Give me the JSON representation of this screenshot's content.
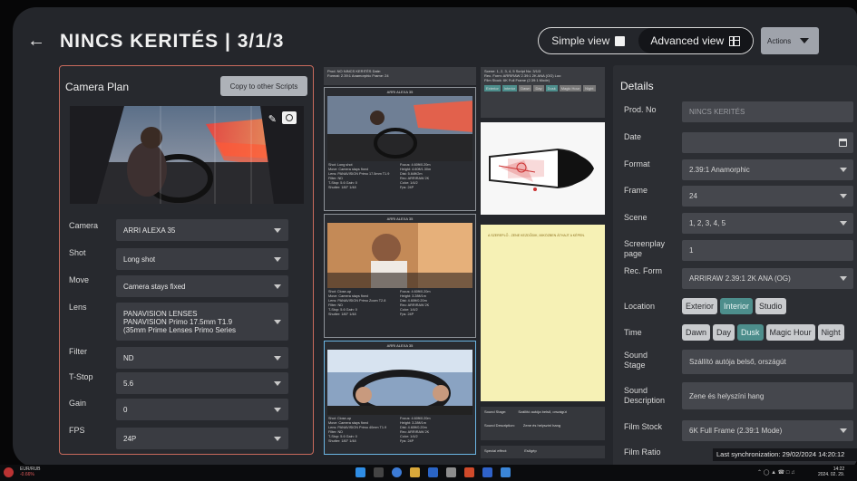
{
  "header": {
    "back_icon": "arrow-left-icon",
    "title": "NINCS KERITÉS | 3/1/3",
    "simple_view": "Simple view",
    "advanced_view": "Advanced view",
    "actions": "Actions"
  },
  "camera_plan": {
    "title": "Camera Plan",
    "copy_button": "Copy to other Scripts",
    "fields": [
      {
        "label": "Camera",
        "value": "ARRI ALEXA 35"
      },
      {
        "label": "Shot",
        "value": "Long shot"
      },
      {
        "label": "Move",
        "value": "Camera stays fixed"
      },
      {
        "label": "Lens",
        "value": "PANAVISION LENSES\nPANAVISION Primo 17.5mm T1.9\n(35mm Prime Lenses Primo Series"
      },
      {
        "label": "Filter",
        "value": "ND"
      },
      {
        "label": "T-Stop",
        "value": "5.6"
      },
      {
        "label": "Gain",
        "value": "0"
      },
      {
        "label": "FPS",
        "value": "24P"
      }
    ]
  },
  "script_pages": {
    "header_lines": [
      "Prod. NO  NINCS KERITÉS          Date:",
      "Format:  2.39:1 Anamorphic             Frame:  24"
    ],
    "scene_lines": [
      "Scene:   1, 2, 3, 4, 5          Script No:  3/1/3",
      "Rec. Form:  ARRIRAW 2.39:1 2K ANA (OG)   Loc:",
      "Film Stock:  6K Full Frame (2.39:1 Mode)"
    ],
    "shots": [
      {
        "header": "ARRI ALEXA 35",
        "meta": [
          "Shot:  Long shot",
          "Focus:  4.60ft/0.20m",
          "Move:  Camera stays fixed",
          "Height:  4.60ft/1.30m",
          "Lens:  PANAVISION Primo 17.5mm T1.9",
          "Dist:  5.64ft/2m",
          "Filter:  ND",
          "Rec:  ARRIRAW 2K",
          "T-Stop:  5.6   Gain: 0",
          "Color:  1/4/2",
          "Shutter:  180°   1/48",
          "Fps:  24P"
        ]
      },
      {
        "header": "ARRI ALEXA 35",
        "meta": [
          "Shot:  Close-up",
          "Focus:  4.60ft/0.20m",
          "Move:  Camera stays fixed",
          "Height:  3.28ft/1m",
          "Lens:  PANAVISION Primo Zoom T2.8",
          "Dist:  4.60ft/0.20m",
          "Filter:  ND",
          "Rec:  ARRIRAW 2K",
          "T-Stop:  5.6   Gain: 0",
          "Color:  1/4/2",
          "Shutter:  180°   1/48",
          "Fps:  24P"
        ]
      },
      {
        "header": "ARRI ALEXA 35",
        "meta": [
          "Shot:  Close-up",
          "Focus:  4.60ft/0.20m",
          "Move:  Camera stays fixed",
          "Height:  3.28ft/1m",
          "Lens:  PANAVISION Primo 40mm T1.9",
          "Dist:  4.60ft/0.20m",
          "Filter:  ND",
          "Rec:  ARRIRAW 2K",
          "T-Stop:  5.6   Gain: 0",
          "Color:  1/4/2",
          "Shutter:  180°   1/48",
          "Fps:  24P"
        ]
      }
    ],
    "chips": [
      "Exterior",
      "Interior",
      "Dawn",
      "Day",
      "Dusk",
      "Magic Hour",
      "Night"
    ],
    "note_text": "A SZEREPLŐ - ZENE KEZDŐDIK, MIKÖZBEN ÁTHAJT A KÉPEN.",
    "bottom_meta": [
      {
        "label": "Sound Stage:",
        "value": "Szállító autója belső, országút"
      },
      {
        "label": "Sound Description:",
        "value": "Zene és helyszíni hang"
      },
      {
        "label": "Special effect:",
        "value": "Esőgép"
      }
    ]
  },
  "details": {
    "title": "Details",
    "prod_no": {
      "label": "Prod. No",
      "value": "NINCS KERITÉS"
    },
    "date": {
      "label": "Date",
      "value": ""
    },
    "format": {
      "label": "Format",
      "value": "2.39:1 Anamorphic"
    },
    "frame": {
      "label": "Frame",
      "value": "24"
    },
    "scene": {
      "label": "Scene",
      "value": "1, 2, 3, 4, 5"
    },
    "screenplay_page": {
      "label": "Screenplay page",
      "value": "1"
    },
    "rec_form": {
      "label": "Rec. Form",
      "value": "ARRIRAW 2.39:1 2K ANA (OG)"
    },
    "location": {
      "label": "Location",
      "options": [
        "Exterior",
        "Interior",
        "Studio"
      ],
      "selected": "Interior"
    },
    "time": {
      "label": "Time",
      "options": [
        "Dawn",
        "Day",
        "Dusk",
        "Magic Hour",
        "Night"
      ],
      "selected": "Dusk"
    },
    "sound_stage": {
      "label": "Sound Stage",
      "value": "Szállító autója belső, országút"
    },
    "sound_description": {
      "label": "Sound Description",
      "value": "Zene és helyszíni hang"
    },
    "film_stock": {
      "label": "Film Stock",
      "value": "6K Full Frame (2.39:1 Mode)"
    },
    "film_ratio": {
      "label": "Film Ratio"
    }
  },
  "sync": "Last synchronization: 29/02/2024 14:20:12",
  "taskbar": {
    "ticker_name": "EUR/RUB",
    "ticker_change": "-0.66%",
    "clock_time": "14:22",
    "clock_date": "2024. 02. 29."
  },
  "colors": {
    "accent_teal": "#4d8e8c",
    "panel_border": "#c86a5c",
    "selected_shot": "#6bb6e5"
  }
}
